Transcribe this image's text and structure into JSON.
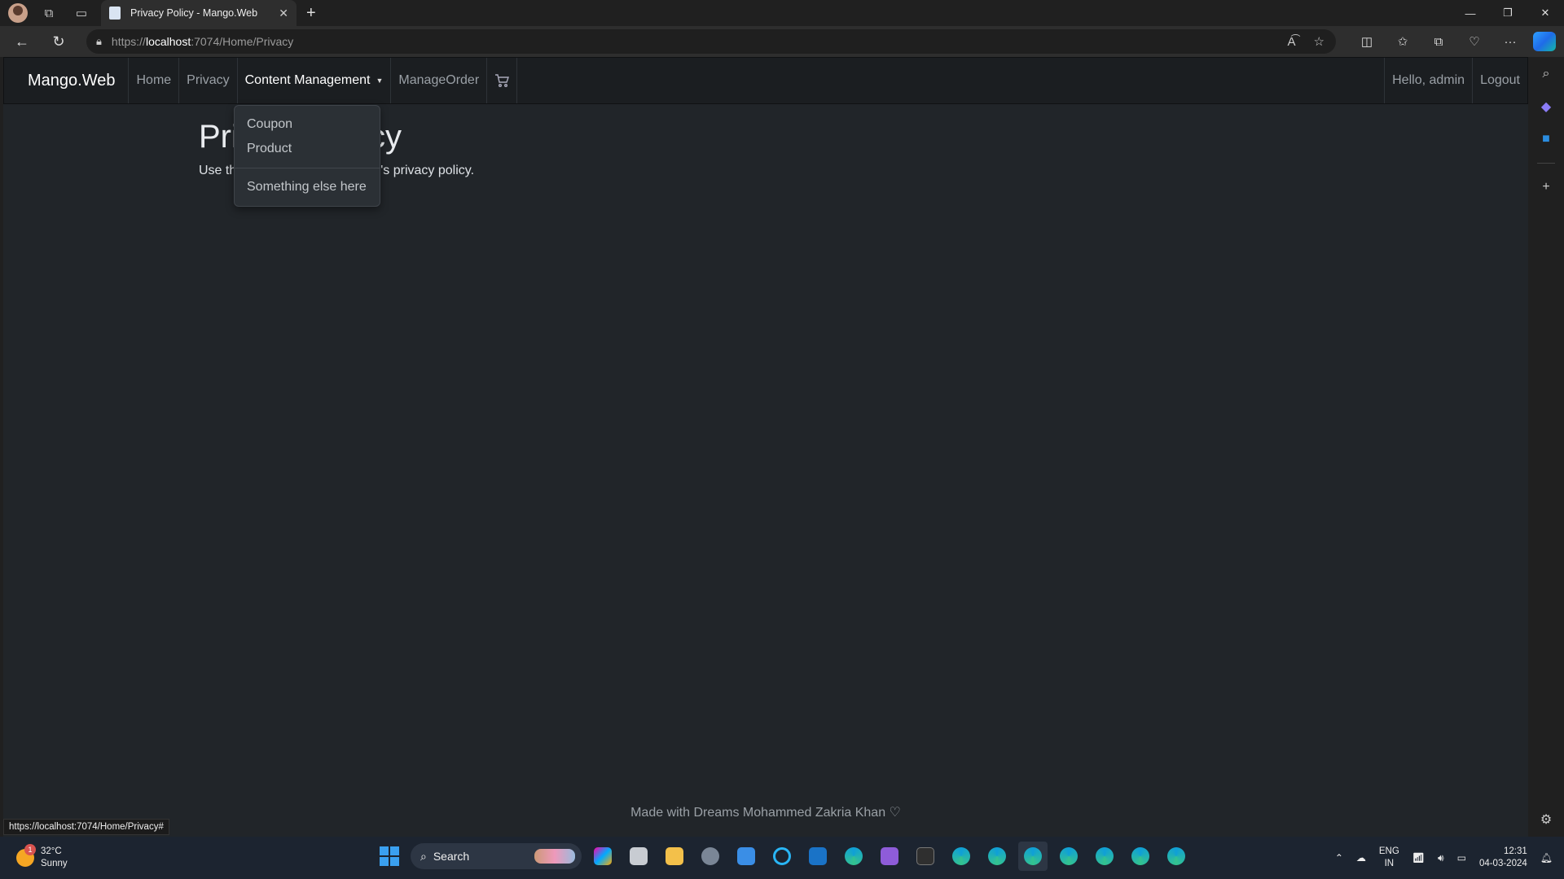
{
  "browser": {
    "tab_title": "Privacy Policy - Mango.Web",
    "url_scheme": "https://",
    "url_host": "localhost",
    "url_rest": ":7074/Home/Privacy",
    "status_url": "https://localhost:7074/Home/Privacy#"
  },
  "navbar": {
    "brand": "Mango.Web",
    "links": {
      "home": "Home",
      "privacy": "Privacy",
      "content_management": "Content Management",
      "manage_order": "ManageOrder"
    },
    "greeting": "Hello, admin",
    "logout": "Logout"
  },
  "dropdown": {
    "coupon": "Coupon",
    "product": "Product",
    "other": "Something else here"
  },
  "page": {
    "heading": "Privacy Policy",
    "lead": "Use this page to detail your site's privacy policy.",
    "footer": "Made with Dreams Mohammed Zakria Khan ♡"
  },
  "taskbar": {
    "temperature": "32°C",
    "weather": "Sunny",
    "weather_badge": "1",
    "search": "Search",
    "lang_top": "ENG",
    "lang_bottom": "IN",
    "time": "12:31",
    "date": "04-03-2024"
  },
  "colors": {
    "page_bg": "#212529",
    "navbar_bg": "#1b1e21",
    "dropdown_bg": "#2b3035",
    "taskbar_bg": "#1c2430"
  }
}
